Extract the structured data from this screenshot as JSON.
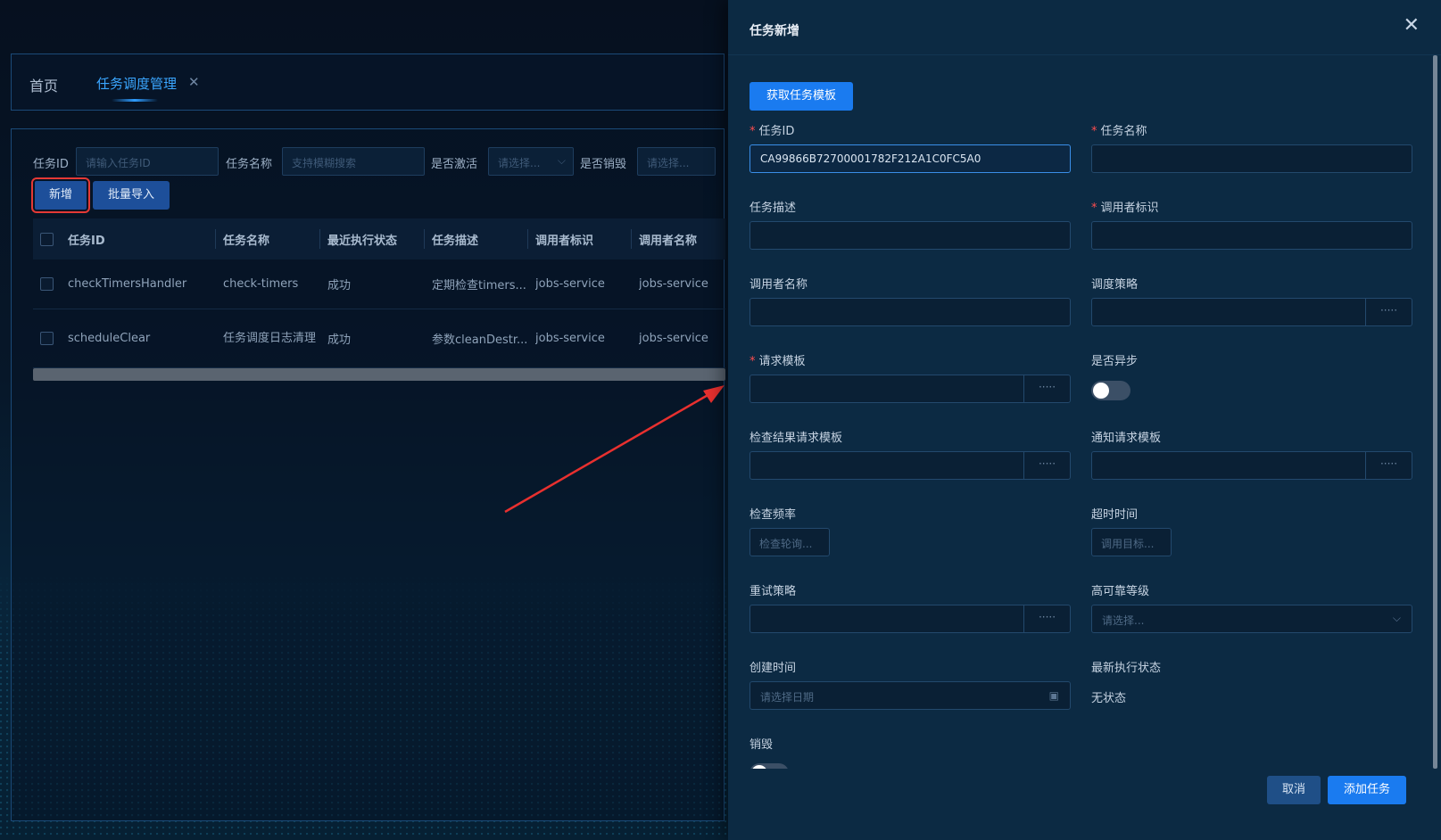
{
  "background": {
    "tabs": {
      "home": "首页",
      "active": "任务调度管理",
      "close_glyph": "✕"
    },
    "filters": {
      "task_id_label": "任务ID",
      "task_id_placeholder": "请输入任务ID",
      "task_name_label": "任务名称",
      "task_name_placeholder": "支持模糊搜索",
      "active_label": "是否激活",
      "active_placeholder": "请选择...",
      "destroyed_label": "是否销毁",
      "destroyed_placeholder": "请选择..."
    },
    "buttons": {
      "add": "新增",
      "bulk_import": "批量导入"
    },
    "table": {
      "columns": [
        "任务ID",
        "任务名称",
        "最近执行状态",
        "任务描述",
        "调用者标识",
        "调用者名称"
      ],
      "rows": [
        [
          "checkTimersHandler",
          "check-timers",
          "成功",
          "定期检查timers...",
          "jobs-service",
          "jobs-service"
        ],
        [
          "scheduleClear",
          "任务调度日志清理",
          "成功",
          "参数cleanDestr...",
          "jobs-service",
          "jobs-service"
        ]
      ]
    }
  },
  "drawer": {
    "title": "任务新增",
    "close_glyph": "✕",
    "get_template_button": "获取任务模板",
    "fields": {
      "task_id": {
        "label": "任务ID",
        "value": "CA99866B72700001782F212A1C0FC5A0"
      },
      "task_name": {
        "label": "任务名称",
        "value": ""
      },
      "task_desc": {
        "label": "任务描述",
        "value": ""
      },
      "caller_id": {
        "label": "调用者标识",
        "value": ""
      },
      "caller_name": {
        "label": "调用者名称",
        "value": ""
      },
      "schedule_policy": {
        "label": "调度策略",
        "value": ""
      },
      "request_template": {
        "label": "请求模板",
        "value": ""
      },
      "is_async": {
        "label": "是否异步"
      },
      "check_result_template": {
        "label": "检查结果请求模板",
        "value": ""
      },
      "notify_template": {
        "label": "通知请求模板",
        "value": ""
      },
      "check_frequency": {
        "label": "检查频率",
        "placeholder": "检查轮询..."
      },
      "timeout": {
        "label": "超时时间",
        "placeholder": "调用目标..."
      },
      "retry_policy": {
        "label": "重试策略",
        "value": ""
      },
      "ha_level": {
        "label": "高可靠等级",
        "placeholder": "请选择..."
      },
      "created_at": {
        "label": "创建时间",
        "placeholder": "请选择日期"
      },
      "latest_status": {
        "label": "最新执行状态",
        "value": "无状态"
      },
      "destroy": {
        "label": "销毁"
      }
    },
    "addon_glyph": "·····",
    "footer": {
      "cancel": "取消",
      "submit": "添加任务"
    }
  }
}
